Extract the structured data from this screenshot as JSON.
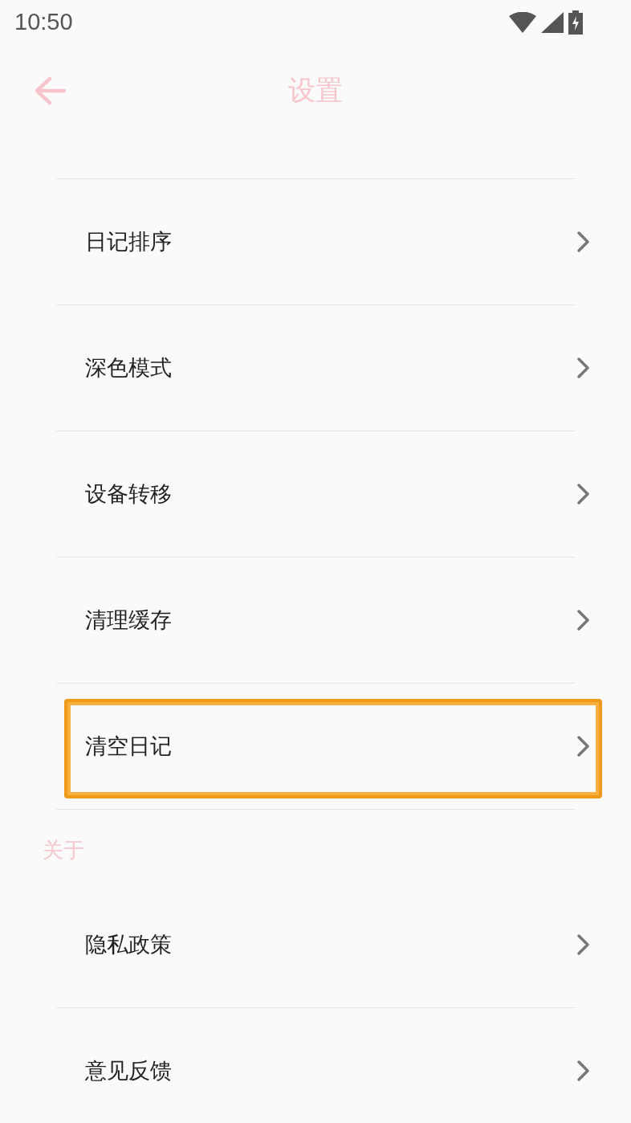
{
  "status_bar": {
    "time": "10:50"
  },
  "header": {
    "title": "设置"
  },
  "sections": [
    {
      "items": [
        {
          "label": "日记排序",
          "highlighted": false
        },
        {
          "label": "深色模式",
          "highlighted": false
        },
        {
          "label": "设备转移",
          "highlighted": false
        },
        {
          "label": "清理缓存",
          "highlighted": false
        },
        {
          "label": "清空日记",
          "highlighted": true
        }
      ]
    },
    {
      "heading": "关于",
      "items": [
        {
          "label": "隐私政策",
          "highlighted": false
        },
        {
          "label": "意见反馈",
          "highlighted": false
        }
      ]
    }
  ]
}
